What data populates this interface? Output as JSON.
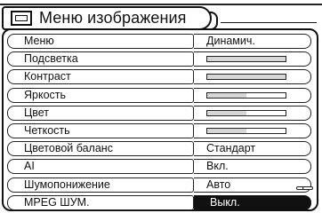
{
  "menu": {
    "title": "Меню изображения",
    "items": [
      {
        "label": "Меню",
        "value": "Динамич.",
        "type": "text"
      },
      {
        "label": "Подсветка",
        "value": null,
        "type": "bar",
        "level": 1.0
      },
      {
        "label": "Контраст",
        "value": null,
        "type": "bar",
        "level": 1.0
      },
      {
        "label": "Яркость",
        "value": null,
        "type": "bar",
        "level": 0.5
      },
      {
        "label": "Цвет",
        "value": null,
        "type": "bar",
        "level": 0.5
      },
      {
        "label": "Четкость",
        "value": null,
        "type": "bar",
        "level": 0.5
      },
      {
        "label": "Цветовой баланс",
        "value": "Стандарт",
        "type": "text"
      },
      {
        "label": "AI",
        "value": "Вкл.",
        "type": "text"
      },
      {
        "label": "Шумопонижение",
        "value": "Авто",
        "type": "text"
      },
      {
        "label": "MPEG ШУМ.",
        "value": "Выкл.",
        "type": "text",
        "selected": true
      }
    ]
  },
  "colors": {
    "foreground": "#111111",
    "background": "#ffffff",
    "bar_fill": "#d7d7d7",
    "selected_bg": "#111111"
  },
  "icons": {
    "title": "picture-menu-icon"
  }
}
